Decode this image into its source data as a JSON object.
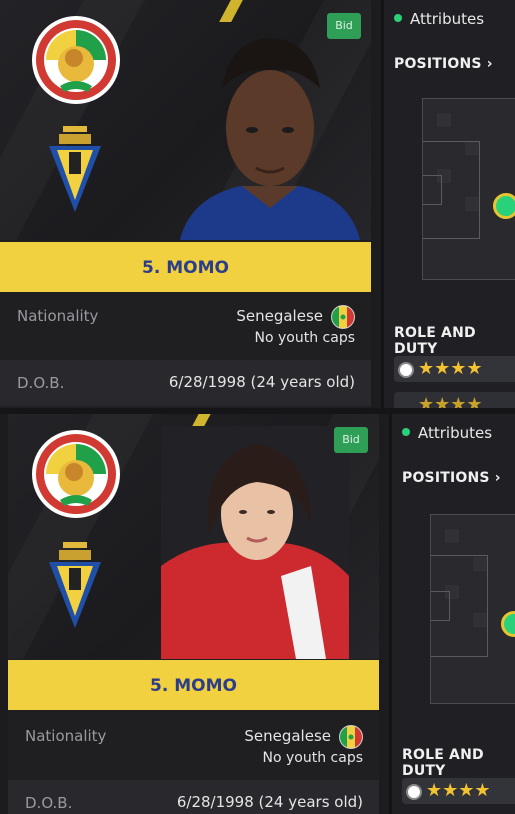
{
  "panels": [
    {
      "bid_label": "Bid",
      "player_name": "5. MOMO",
      "nationality_label": "Nationality",
      "nationality_value": "Senegalese",
      "youth_caps": "No youth caps",
      "dob_label": "D.O.B.",
      "dob_value": "6/28/1998 (24 years old)",
      "side": {
        "attributes_label": "Attributes",
        "positions_label": "POSITIONS",
        "role_label": "ROLE AND DUTY"
      }
    },
    {
      "bid_label": "Bid",
      "player_name": "5. MOMO",
      "nationality_label": "Nationality",
      "nationality_value": "Senegalese",
      "youth_caps": "No youth caps",
      "dob_label": "D.O.B.",
      "dob_value": "6/28/1998 (24 years old)",
      "side": {
        "attributes_label": "Attributes",
        "positions_label": "POSITIONS",
        "role_label": "ROLE AND DUTY"
      }
    }
  ],
  "colors": {
    "accent_yellow": "#f2d140",
    "name_text": "#2c3e8a",
    "bid_green": "#2f9e56",
    "status_green": "#29d27a"
  },
  "icons": [
    "senegal-federation-crest",
    "cadiz-club-crest",
    "senegal-flag-icon",
    "chevron-right-icon",
    "star-icon"
  ]
}
